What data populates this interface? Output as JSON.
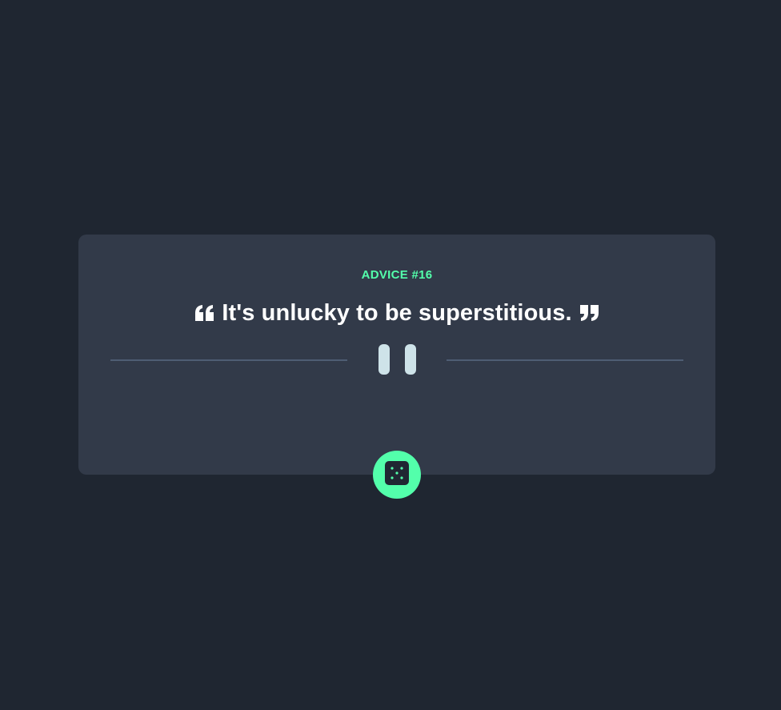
{
  "advice": {
    "label": "ADVICE #16",
    "text": "It's unlucky to be superstitious."
  },
  "icons": {
    "open_quote": "open-quote-icon",
    "close_quote": "close-quote-icon",
    "divider": "pause-icon",
    "dice": "dice-icon"
  },
  "colors": {
    "background": "#1f2631",
    "card": "#323a49",
    "accent": "#53ffab",
    "text": "#ffffff",
    "divider": "#4e5d73",
    "pause": "#cee3e9"
  }
}
